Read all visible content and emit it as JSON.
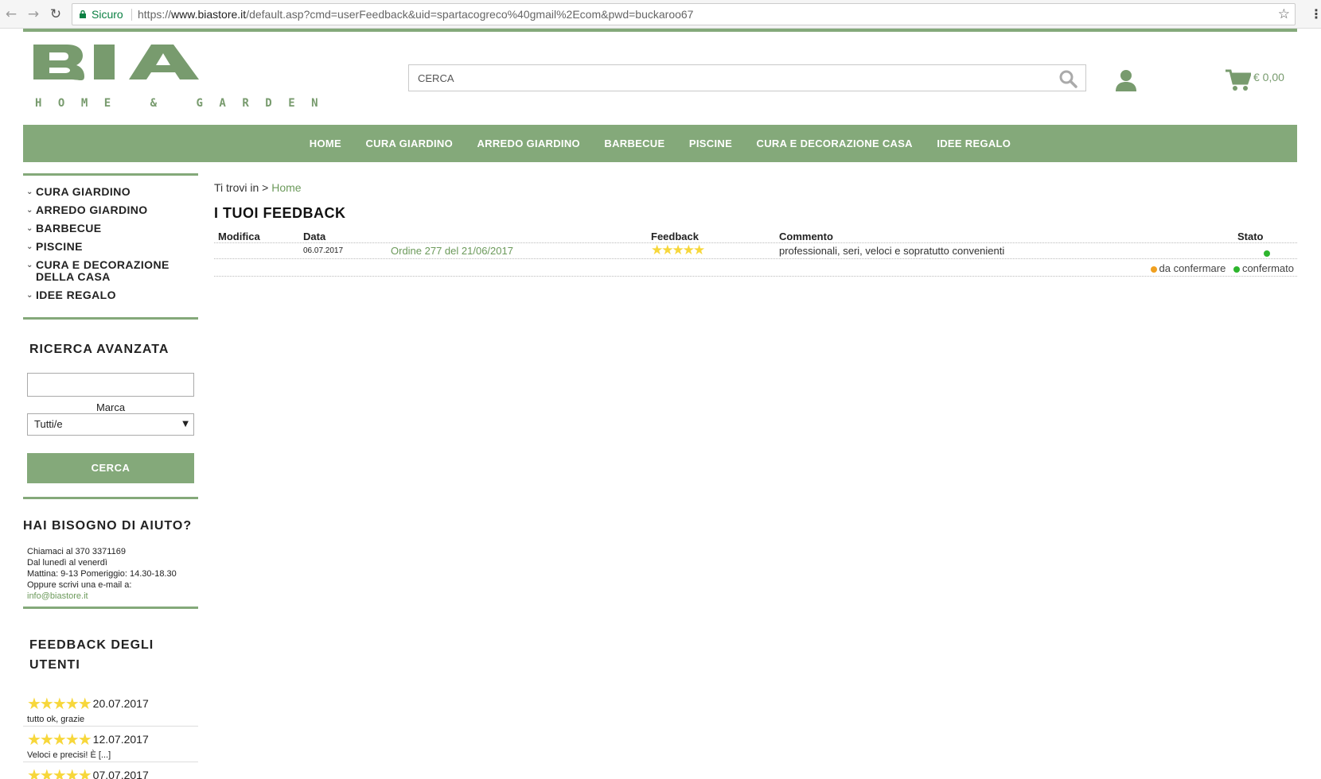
{
  "browser": {
    "secure_label": "Sicuro",
    "url_scheme": "https://",
    "url_host": "www.biastore.it",
    "url_path": "/default.asp?cmd=userFeedback&uid=spartacogreco%40gmail%2Ecom&pwd=buckaroo67"
  },
  "header": {
    "logo_text": "BIA",
    "logo_subtitle": "HOME & GARDEN",
    "search_placeholder": "CERCA",
    "cart_total": "€ 0,00",
    "brand_color": "#84a97a"
  },
  "nav": {
    "items": [
      "HOME",
      "CURA GIARDINO",
      "ARREDO GIARDINO",
      "BARBECUE",
      "PISCINE",
      "CURA E DECORAZIONE CASA",
      "IDEE REGALO"
    ]
  },
  "sidebar": {
    "categories": [
      "CURA GIARDINO",
      "ARREDO GIARDINO",
      "BARBECUE",
      "PISCINE",
      "CURA E DECORAZIONE DELLA CASA",
      "IDEE REGALO"
    ],
    "advanced_search": {
      "title": "RICERCA AVANZATA",
      "brand_label": "Marca",
      "brand_selected": "Tutti/e",
      "button_label": "CERCA"
    },
    "help": {
      "title": "HAI BISOGNO DI AIUTO?",
      "line1": "Chiamaci al 370 3371169",
      "line2": "Dal lunedì al venerdì",
      "line3": "Mattina: 9-13 Pomeriggio: 14.30-18.30",
      "line4": "Oppure scrivi una e-mail a:",
      "email": "info@biastore.it"
    },
    "user_feedback": {
      "title": "FEEDBACK DEGLI UTENTI",
      "items": [
        {
          "stars": "★★★★★",
          "date": "20.07.2017",
          "text": "tutto ok, grazie"
        },
        {
          "stars": "★★★★★",
          "date": "12.07.2017",
          "text": "Veloci e precisi! È [...]"
        },
        {
          "stars": "★★★★★",
          "date": "07.07.2017",
          "text": ""
        }
      ]
    }
  },
  "main": {
    "breadcrumb_prefix": "Ti trovi in >",
    "breadcrumb_home": "Home",
    "title": "I TUOI FEEDBACK",
    "table": {
      "headers": [
        "Modifica",
        "Data",
        "Feedback",
        "Commento",
        "Stato"
      ],
      "rows": [
        {
          "date": "06.07.2017",
          "order": "Ordine 277 del 21/06/2017",
          "stars": "★★★★★",
          "comment": "professionali, seri, veloci e sopratutto convenienti",
          "status": "confermato"
        }
      ],
      "legend_pending": "da confermare",
      "legend_confirmed": "confermato"
    }
  }
}
